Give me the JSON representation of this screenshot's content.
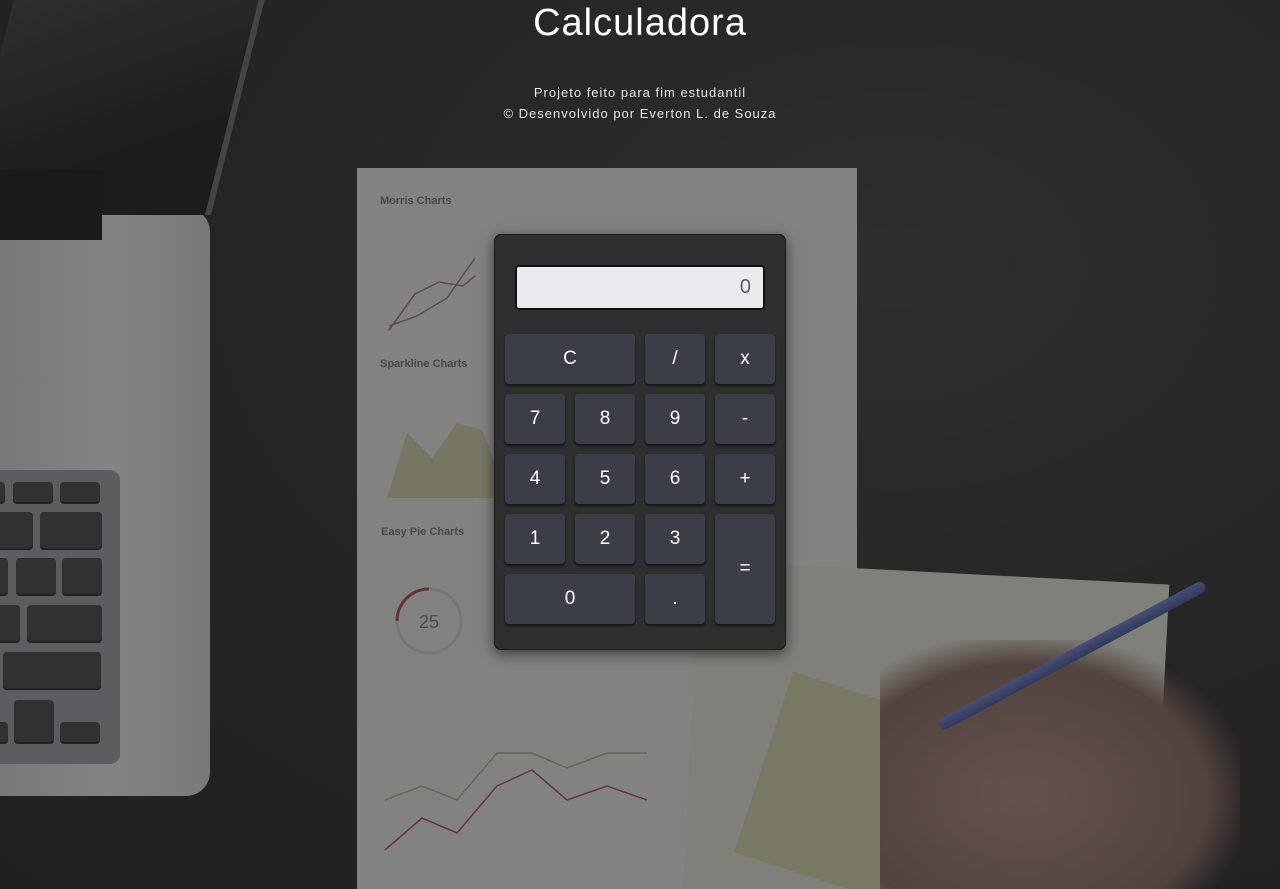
{
  "header": {
    "title": "Calculadora",
    "subtitle_line1": "Projeto feito para fim estudantil",
    "subtitle_line2": "© Desenvolvido por Everton L. de Souza"
  },
  "background": {
    "paper_labels": {
      "morris": "Morris Charts",
      "sparkline": "Sparkline Charts",
      "easy_pie": "Easy Pie Charts",
      "pie_value": "25"
    }
  },
  "calculator": {
    "display_value": "0",
    "buttons": {
      "clear": "C",
      "divide": "/",
      "multiply": "x",
      "seven": "7",
      "eight": "8",
      "nine": "9",
      "minus": "-",
      "four": "4",
      "five": "5",
      "six": "6",
      "plus": "+",
      "one": "1",
      "two": "2",
      "three": "3",
      "equals": "=",
      "zero": "0",
      "decimal": "."
    }
  },
  "colors": {
    "calculator_body": "#2f2f2f",
    "button": "#3b3e46",
    "display_bg": "#e9ebee"
  }
}
